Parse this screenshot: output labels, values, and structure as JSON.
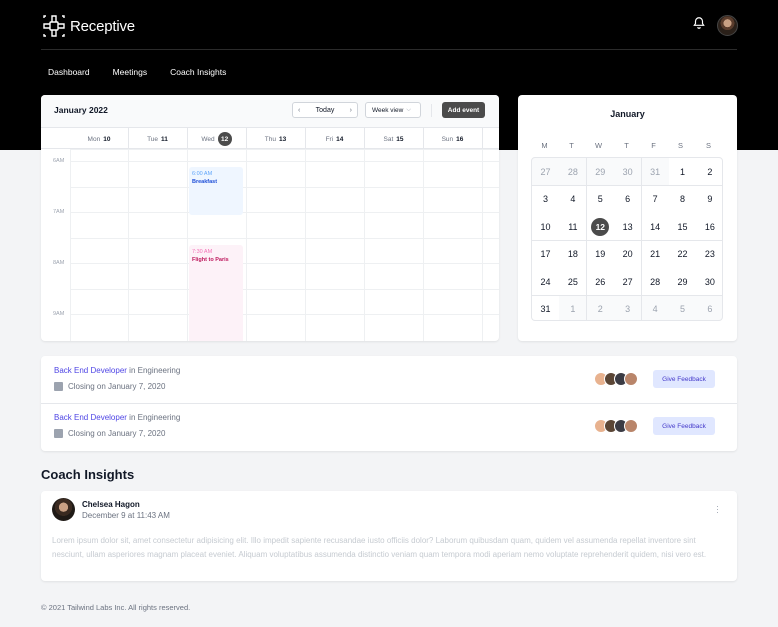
{
  "brand": {
    "name": "Receptive"
  },
  "nav": [
    {
      "label": "Dashboard"
    },
    {
      "label": "Meetings"
    },
    {
      "label": "Coach Insights"
    }
  ],
  "week_calendar": {
    "title": "January 2022",
    "today_label": "Today",
    "view_select": "Week view",
    "add_event": "Add event",
    "days": [
      {
        "dow": "Mon",
        "num": "10"
      },
      {
        "dow": "Tue",
        "num": "11"
      },
      {
        "dow": "Wed",
        "num": "12"
      },
      {
        "dow": "Thu",
        "num": "13"
      },
      {
        "dow": "Fri",
        "num": "14"
      },
      {
        "dow": "Sat",
        "num": "15"
      },
      {
        "dow": "Sun",
        "num": "16"
      }
    ],
    "times": [
      "6AM",
      "7AM",
      "8AM",
      "9AM"
    ],
    "events": [
      {
        "time": "6:00 AM",
        "name": "Breakfast"
      },
      {
        "time": "7:30 AM",
        "name": "Flight to Paris"
      }
    ]
  },
  "month_calendar": {
    "title": "January",
    "dow": [
      "M",
      "T",
      "W",
      "T",
      "F",
      "S",
      "S"
    ],
    "weeks": [
      [
        "27",
        "28",
        "29",
        "30",
        "31",
        "1",
        "2"
      ],
      [
        "3",
        "4",
        "5",
        "6",
        "7",
        "8",
        "9"
      ],
      [
        "10",
        "11",
        "12",
        "13",
        "14",
        "15",
        "16"
      ],
      [
        "17",
        "18",
        "19",
        "20",
        "21",
        "22",
        "23"
      ],
      [
        "24",
        "25",
        "26",
        "27",
        "28",
        "29",
        "30"
      ],
      [
        "31",
        "1",
        "2",
        "3",
        "4",
        "5",
        "6"
      ]
    ],
    "selected": "12"
  },
  "jobs": [
    {
      "role": "Back End Developer",
      "in_text": " in Engineering",
      "closing": "Closing on January 7, 2020",
      "button": "Give Feedback"
    },
    {
      "role": "Back End Developer",
      "in_text": " in Engineering",
      "closing": "Closing on January 7, 2020",
      "button": "Give Feedback"
    }
  ],
  "coach_insights": {
    "title": "Coach Insights",
    "author": "Chelsea Hagon",
    "date": "December 9 at 11:43 AM",
    "body": "Lorem ipsum dolor sit, amet consectetur adipisicing elit. Illo impedit sapiente recusandae iusto officiis dolor? Laborum quibusdam quam, quidem vel assumenda repellat inventore sint nesciunt, ullam asperiores magnam placeat eveniet. Aliquam voluptatibus assumenda distinctio veniam quam tempora modi aperiam nemo voluptate reprehenderit quidem, nisi vero est."
  },
  "footer": {
    "text": "© 2021 Tailwind Labs Inc. All rights reserved."
  },
  "colors": {
    "accent": "#4f46e5",
    "dark": "#4b4b4b",
    "header": "#000000"
  }
}
